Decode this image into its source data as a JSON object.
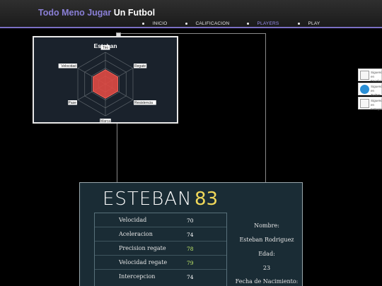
{
  "header": {
    "title_part1": "Todo Meno Jugar",
    "title_part2": "Un Futbol",
    "accent_color": "#8a7fd6"
  },
  "nav": {
    "items": [
      {
        "label": "INICIO",
        "active": false
      },
      {
        "label": "CALIFICACION",
        "active": false
      },
      {
        "label": "PLAYERS",
        "active": true
      },
      {
        "label": "PLAY",
        "active": false
      }
    ]
  },
  "radar": {
    "title": "Esteban",
    "axes": [
      "Tiro",
      "Regate",
      "Resistencia",
      "Marca",
      "Pase",
      "Velocidad"
    ],
    "values_fraction": [
      0.45,
      0.45,
      0.45,
      0.45,
      0.45,
      0.45
    ],
    "fill_color": "#e04a44"
  },
  "social": {
    "items": [
      {
        "icon": "facebook-icon",
        "text": "Siguenos en Facebook"
      },
      {
        "icon": "twitter-icon",
        "text": "Siguenos en Twitter"
      },
      {
        "icon": "instagram-icon",
        "text": "Siguenos en Instagram"
      }
    ]
  },
  "player": {
    "name": "ESTEBAN",
    "rating": "83",
    "stats": [
      {
        "label": "Velocidad",
        "value": "70",
        "highlight": false
      },
      {
        "label": "Aceleracion",
        "value": "74",
        "highlight": false
      },
      {
        "label": "Precision regate",
        "value": "78",
        "highlight": true
      },
      {
        "label": "Velocidad regate",
        "value": "79",
        "highlight": true
      },
      {
        "label": "Intercepcion",
        "value": "74",
        "highlight": false
      }
    ],
    "info": [
      "Nombre:",
      "Esteban Rodriguez",
      "Edad:",
      "23",
      "Fecha de Nacimiento:"
    ]
  }
}
